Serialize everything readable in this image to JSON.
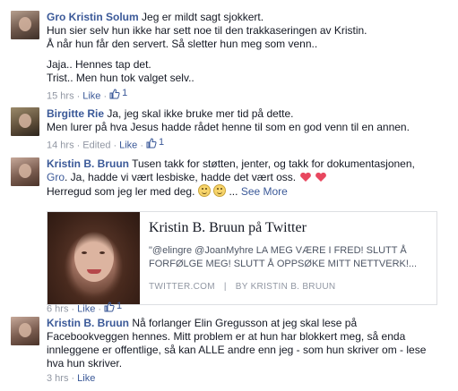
{
  "comments": [
    {
      "author": "Gro Kristin Solum",
      "lines": [
        "Jeg er mildt sagt sjokkert.",
        "Hun sier selv hun ikke har sett noe til den trakkaseringen av Kristin.",
        "Å når hun får den servert. Så sletter hun meg som venn..",
        "",
        "Jaja.. Hennes tap det.",
        "Trist.. Men hun tok valget selv.."
      ],
      "time": "15 hrs",
      "like_label": "Like",
      "like_count": "1"
    },
    {
      "author": "Birgitte Rie",
      "lines": [
        "Ja, jeg skal ikke bruke mer tid på dette.",
        "Men lurer på hva Jesus hadde rådet henne til som en god venn til en annen."
      ],
      "time": "14 hrs",
      "edited": "Edited",
      "like_label": "Like",
      "like_count": "1"
    },
    {
      "author": "Kristin B. Bruun",
      "line1": "Tusen takk for støtten, jenter, og takk for dokumentasjonen,",
      "mention": "Gro",
      "line2_rest": ". Ja, hadde vi vært lesbiske, hadde det vært oss.",
      "line3": "Herregud som jeg ler med deg.",
      "see_more": "See More",
      "emoji_1": "smile-emoji",
      "emoji_2": "smile-emoji",
      "heart_icons": [
        "heart-icon",
        "heart-icon"
      ],
      "accent_heart": "#e8475f",
      "card": {
        "title": "Kristin B. Bruun på Twitter",
        "description": "\"@elingre @JoanMyhre LA MEG VÆRE I FRED! SLUTT Å FORFØLGE MEG! SLUTT Å OPPSØKE MITT NETTVERK!...",
        "domain": "TWITTER.COM",
        "divider": "|",
        "byline": "BY KRISTIN B. BRUUN"
      },
      "time": "6 hrs",
      "like_label": "Like",
      "like_count": "1"
    },
    {
      "author": "Kristin B. Bruun",
      "lines": [
        "Nå forlanger Elin Gregusson at jeg skal lese på",
        "Facebookveggen hennes. Mitt problem er at hun har blokkert meg, så enda",
        "innleggene er offentlige, så kan ALLE andre enn jeg - som hun skriver om - lese",
        "hva hun skriver."
      ],
      "time": "3 hrs",
      "like_label": "Like"
    }
  ],
  "colors": {
    "link": "#3b5998",
    "meta": "#9197a3",
    "text": "#141823"
  },
  "separator": "·"
}
